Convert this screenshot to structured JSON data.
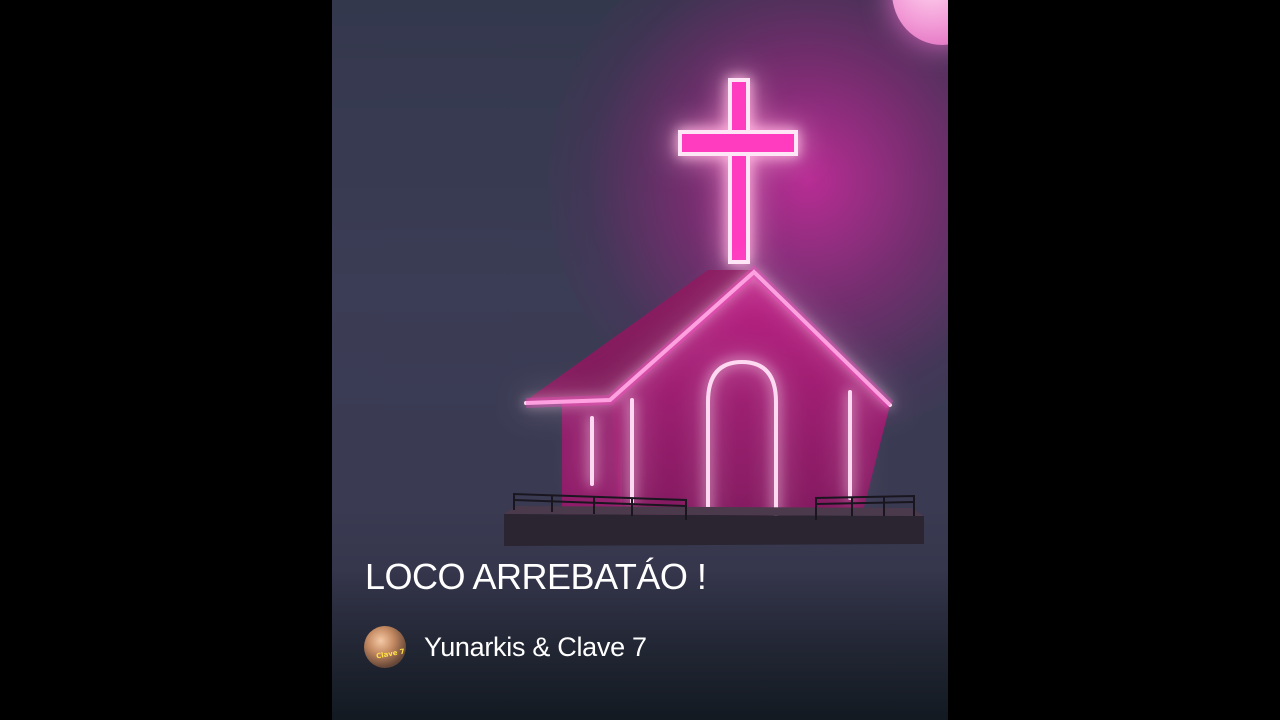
{
  "video": {
    "title": "LOCO ARREBATÁO !",
    "artist": "Yunarkis & Clave 7",
    "avatar_label": "Clave 7"
  },
  "colors": {
    "background": "#000000",
    "neon_pink": "#ff2fb8",
    "neon_white": "#ffe6f6",
    "text": "#ffffff"
  },
  "icons": {
    "artwork": "neon-church-with-cross",
    "avatar": "artist-avatar"
  }
}
